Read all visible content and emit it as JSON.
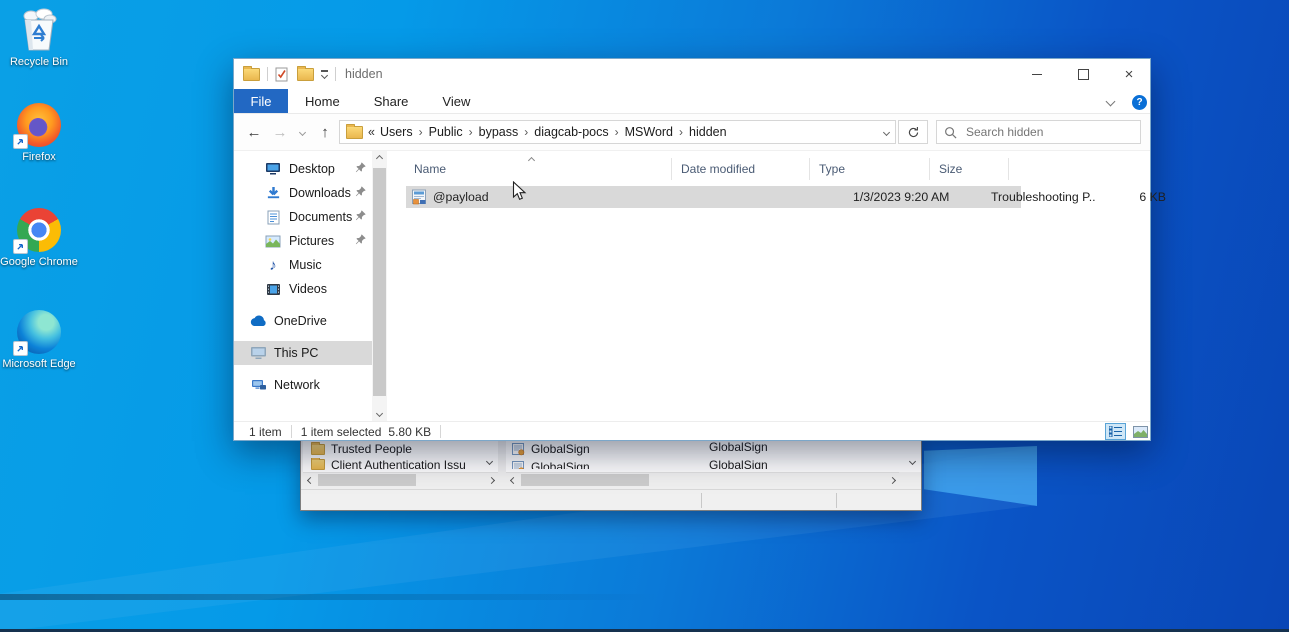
{
  "desktop": {
    "icons": [
      {
        "label": "Recycle Bin"
      },
      {
        "label": "Firefox"
      },
      {
        "label": "Google Chrome"
      },
      {
        "label": "Microsoft Edge"
      }
    ]
  },
  "explorer": {
    "title": "hidden",
    "tabs": {
      "file": "File",
      "home": "Home",
      "share": "Share",
      "view": "View"
    },
    "breadcrumb": {
      "overflow_glyph": "«",
      "separator": "›",
      "items": [
        "Users",
        "Public",
        "bypass",
        "diagcab-pocs",
        "MSWord",
        "hidden"
      ]
    },
    "search": {
      "placeholder": "Search hidden"
    },
    "sidebar": {
      "items": [
        {
          "label": "Desktop",
          "pinned": true
        },
        {
          "label": "Downloads",
          "pinned": true
        },
        {
          "label": "Documents",
          "pinned": true
        },
        {
          "label": "Pictures",
          "pinned": true
        },
        {
          "label": "Music",
          "pinned": false
        },
        {
          "label": "Videos",
          "pinned": false
        },
        {
          "label": "OneDrive",
          "pinned": false
        },
        {
          "label": "This PC",
          "pinned": false,
          "selected": true
        },
        {
          "label": "Network",
          "pinned": false
        }
      ]
    },
    "list": {
      "columns": [
        "Name",
        "Date modified",
        "Type",
        "Size"
      ],
      "rows": [
        {
          "name": "@payload",
          "date_modified": "1/3/2023 9:20 AM",
          "type": "Troubleshooting P...",
          "size": "6 KB",
          "selected": true
        }
      ]
    },
    "status": {
      "item_count": "1 item",
      "selection": "1 item selected",
      "selection_size": "5.80 KB"
    }
  },
  "certmgr": {
    "left_items": [
      "Trusted People",
      "Client Authentication Issu"
    ],
    "right_rows": [
      {
        "col1": "GlobalSign",
        "col2": "GlobalSign"
      },
      {
        "col1": "GlobalSign",
        "col2": "GlobalSign"
      }
    ]
  },
  "icons": {
    "music_note": "♪",
    "help_glyph": "?",
    "close_glyph": "×"
  },
  "colors": {
    "file_tab_blue": "#2268c3",
    "selection_gray": "#d9d9d9",
    "help_blue": "#0a6fd6",
    "wallpaper_light": "#0aa0e6",
    "wallpaper_dark": "#0946b6"
  }
}
